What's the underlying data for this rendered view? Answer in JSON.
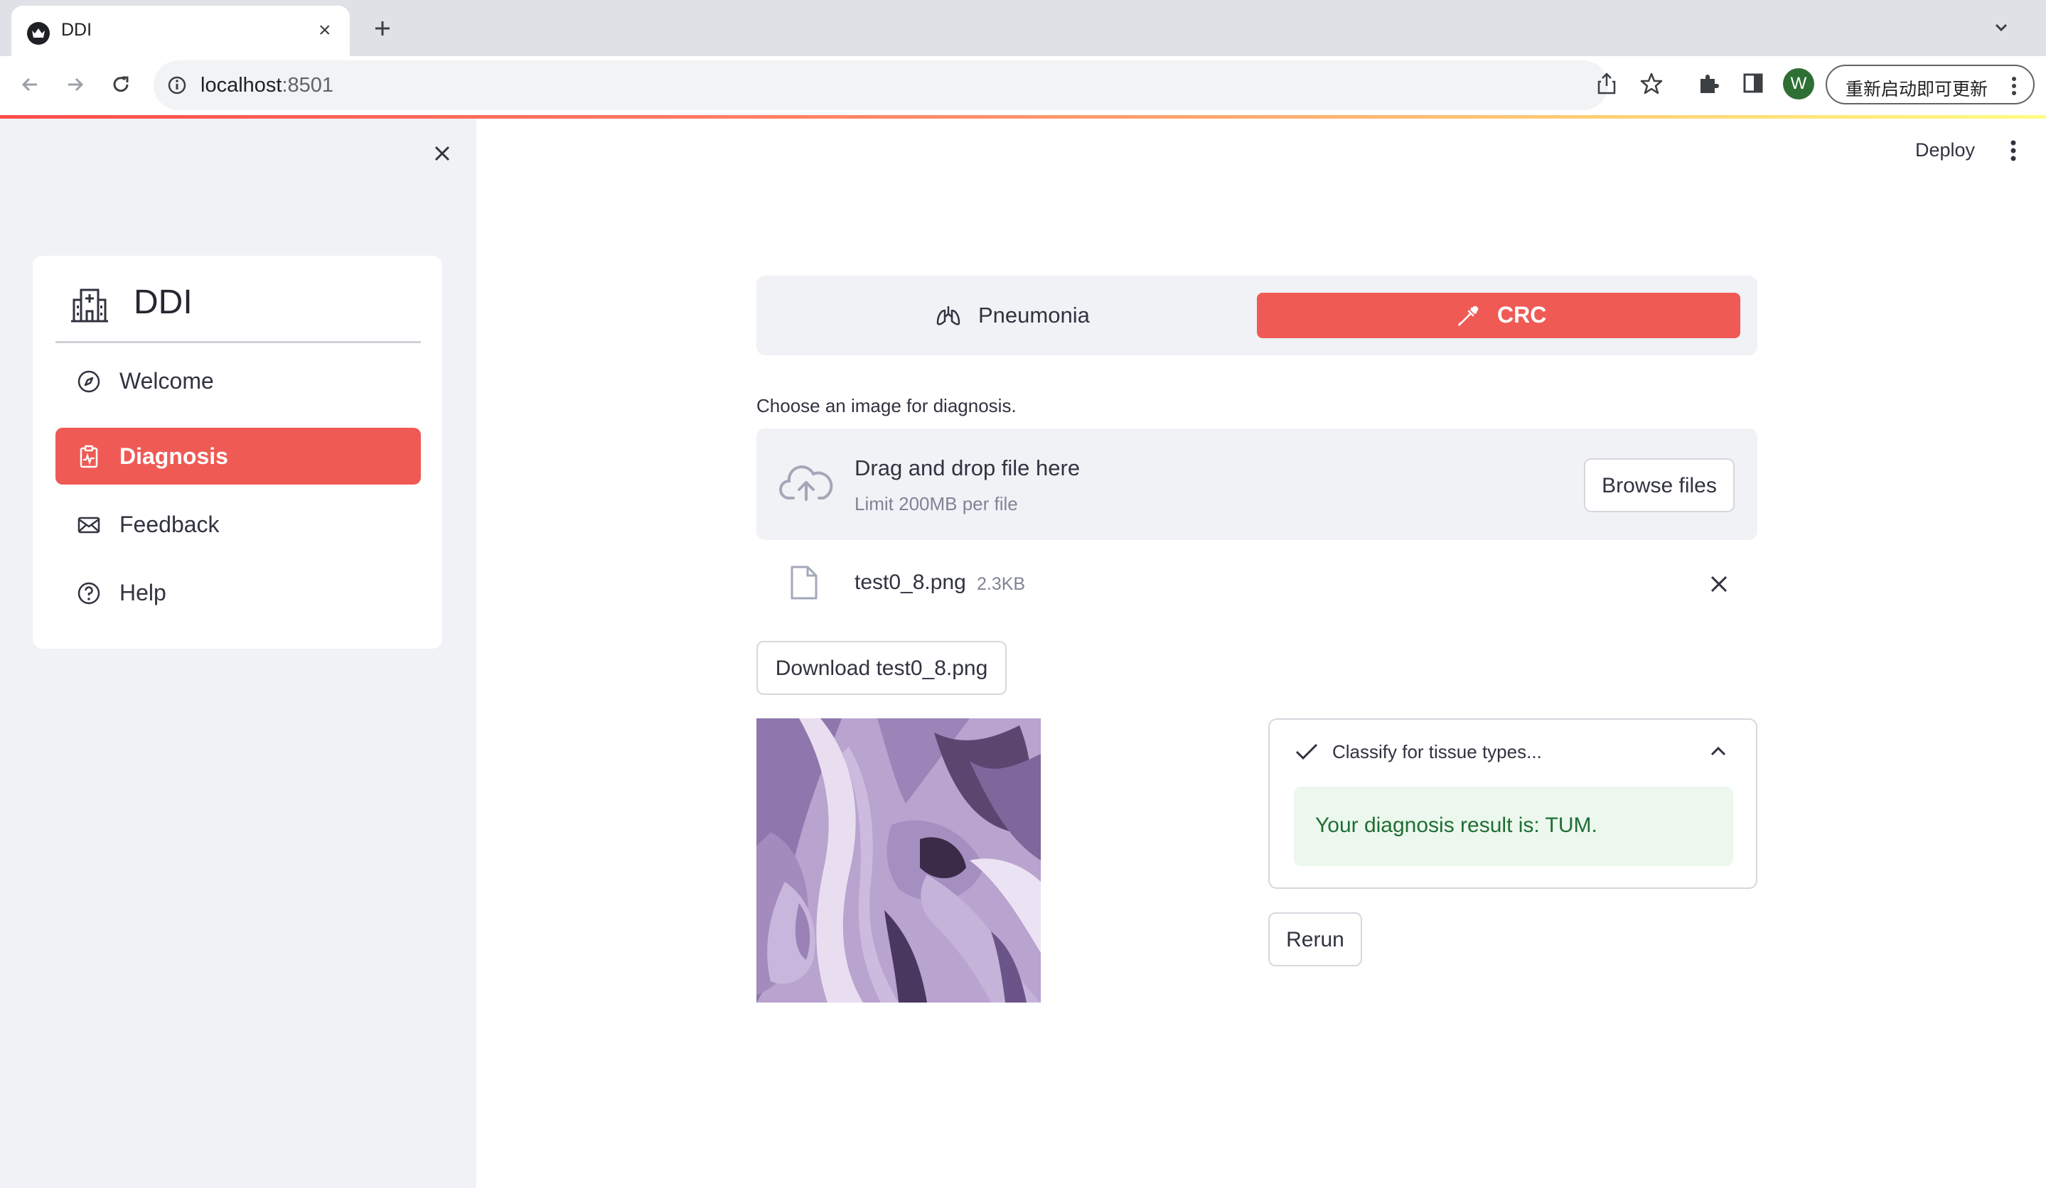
{
  "browser": {
    "tab_title": "DDI",
    "url_host": "localhost",
    "url_port": ":8501",
    "profile_initial": "W",
    "update_label": "重新启动即可更新"
  },
  "app": {
    "deploy_label": "Deploy"
  },
  "sidebar": {
    "title": "DDI",
    "items": [
      {
        "label": "Welcome",
        "icon": "compass-icon"
      },
      {
        "label": "Diagnosis",
        "icon": "clipboard-pulse-icon",
        "active": true
      },
      {
        "label": "Feedback",
        "icon": "envelope-icon"
      },
      {
        "label": "Help",
        "icon": "question-circle-icon"
      }
    ]
  },
  "main": {
    "tabs": [
      {
        "label": "Pneumonia",
        "icon": "lungs-icon",
        "active": false
      },
      {
        "label": "CRC",
        "icon": "eyedropper-icon",
        "active": true
      }
    ],
    "uploader": {
      "label": "Choose an image for diagnosis.",
      "drop_text": "Drag and drop file here",
      "limit_text": "Limit 200MB per file",
      "browse_label": "Browse files"
    },
    "file": {
      "name": "test0_8.png",
      "size": "2.3KB"
    },
    "download_label": "Download test0_8.png",
    "status": {
      "label": "Classify for tissue types...",
      "result": "Your diagnosis result is: TUM."
    },
    "rerun_label": "Rerun"
  },
  "colors": {
    "accent": "#ef5a55",
    "sidebar_bg": "#f0f2f6",
    "success_bg": "#ecf7ee",
    "success_text": "#1f6e33"
  }
}
